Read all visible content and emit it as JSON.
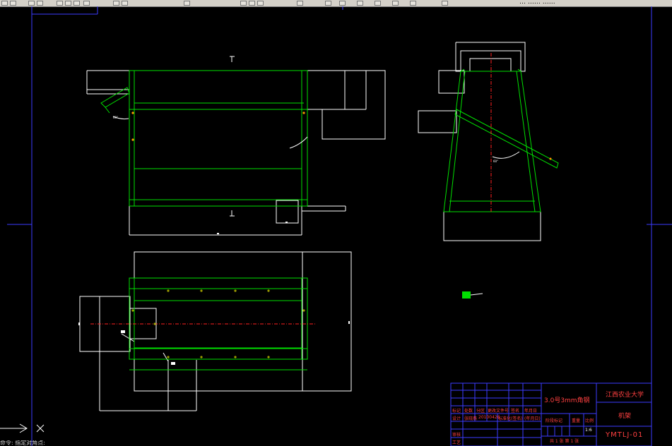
{
  "toolbar": {
    "partial_text": "… ……  ……"
  },
  "drawing": {
    "dims": {
      "angle_front": "60°",
      "angle_side": "60°",
      "label_top": "1:6"
    }
  },
  "title_block": {
    "part_name": "3.0号3mm角钢",
    "school": "江西农业大学",
    "drawing_title": "机架",
    "drawing_no": "YMTLJ-01",
    "scale": "1:6",
    "row_labels": [
      "标记",
      "处数",
      "分区",
      "更改文件号",
      "签名",
      "年月日"
    ],
    "design_labels": [
      "设计",
      "张晓燕",
      "20100426",
      "标准化",
      "(签名)",
      "(年月日)"
    ],
    "check_labels": [
      "审核",
      "工艺"
    ],
    "stage_labels": [
      "阶段标记",
      "重量",
      "比例"
    ],
    "sheet_text": "共 1 张  第 1 张"
  },
  "command": {
    "text": "命令: 指定对角点:"
  }
}
